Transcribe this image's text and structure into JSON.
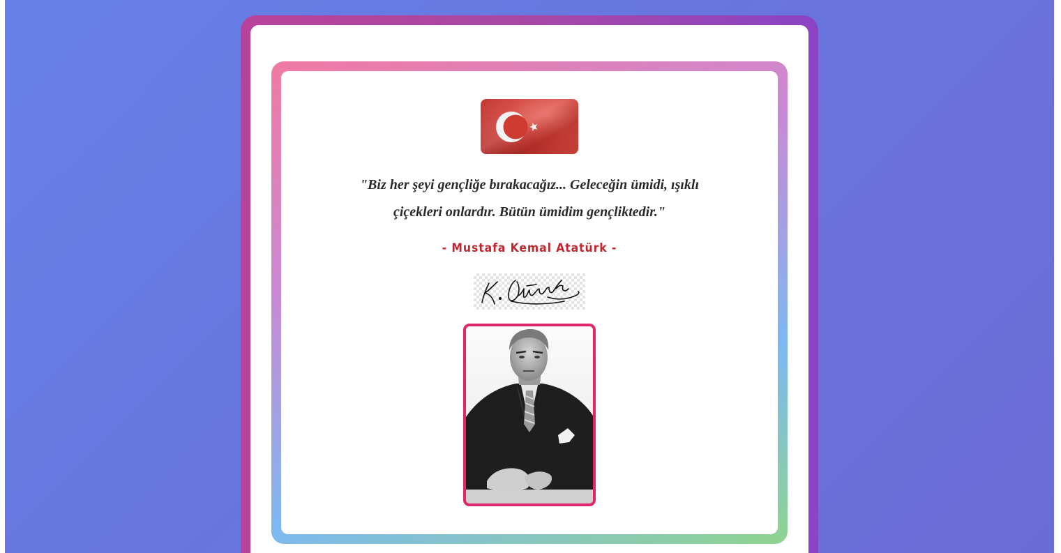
{
  "colors": {
    "page_background": "#6a75e0",
    "outer_frame": "#a848a6",
    "flag_red": "#d23a32",
    "author_red": "#c0262d",
    "portrait_border": "#e0256a"
  },
  "flag": {
    "icon": "turkish-flag-icon"
  },
  "quote": {
    "line1": "\"Biz her şeyi gençliğe bırakacağız... Geleceğin ümidi, ışıklı",
    "line2": "çiçekleri onlardır. Bütün ümidim gençliktedir.\""
  },
  "author": "- Mustafa Kemal Atatürk -",
  "signature": {
    "text": "K. Atatürk"
  },
  "portrait": {
    "icon": "portrait-photo"
  }
}
